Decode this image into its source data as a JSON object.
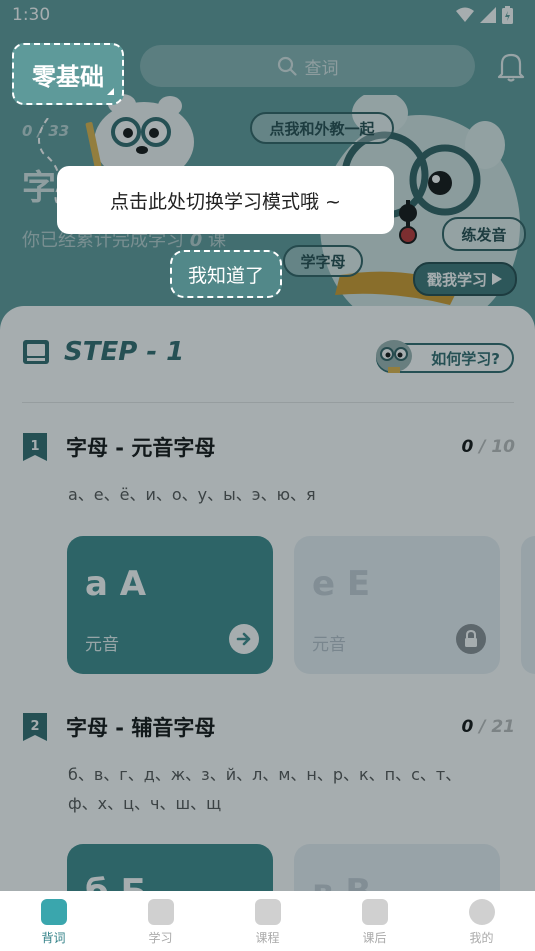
{
  "status": {
    "time": "1:30"
  },
  "header": {
    "mode_label": "零基础",
    "search_placeholder": "查词",
    "progress": {
      "done": "0",
      "total": "33"
    },
    "big_char": "字",
    "studied_prefix": "你已经累计完成学习",
    "studied_count": "0",
    "studied_suffix": "课",
    "chip_foreign": "点我和外教一起",
    "chip_pronunciation": "练发音",
    "chip_letters": "学字母",
    "chip_study": "戳我学习"
  },
  "tutorial": {
    "tooltip": "点击此处切换学习模式哦 ~",
    "got_it": "我知道了"
  },
  "main": {
    "step_title": "STEP - 1",
    "howto_label": "如何学习?",
    "lessons": [
      {
        "num": "1",
        "title": "字母 - 元音字母",
        "done": "0",
        "total": "10",
        "letters": "а、е、ё、и、о、у、ы、э、ю、я",
        "cards": [
          {
            "letter": "a A",
            "type": "元音"
          },
          {
            "letter": "e E",
            "type": "元音"
          }
        ]
      },
      {
        "num": "2",
        "title": "字母 - 辅音字母",
        "done": "0",
        "total": "21",
        "letters": "б、в、г、д、ж、з、й、л、м、н、р、к、п、с、т、ф、х、ц、ч、ш、щ",
        "cards": [
          {
            "letter": "б Б",
            "type": ""
          },
          {
            "letter": "в В",
            "type": ""
          }
        ]
      }
    ]
  },
  "nav": [
    {
      "label": "背词",
      "active": true
    },
    {
      "label": "学习",
      "active": false
    },
    {
      "label": "课程",
      "active": false
    },
    {
      "label": "课后",
      "active": false
    },
    {
      "label": "我的",
      "active": false
    }
  ],
  "colors": {
    "brand": "#5e9a9a",
    "accent": "#2f6a6d",
    "nav_active": "#3aa6ad"
  },
  "icons": [
    "wifi-icon",
    "signal-icon",
    "battery-icon",
    "search-icon",
    "bell-icon",
    "book-icon",
    "arrow-right-icon",
    "lock-icon"
  ]
}
